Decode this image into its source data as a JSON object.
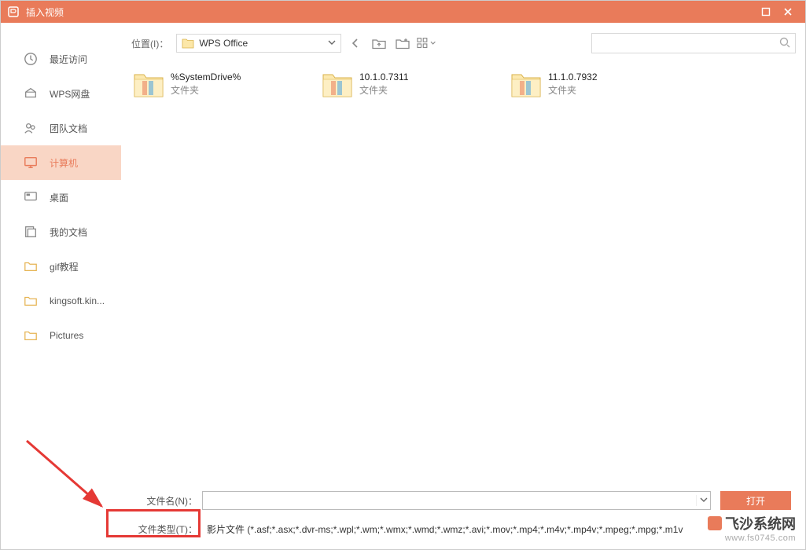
{
  "window": {
    "title": "插入视频"
  },
  "sidebar": {
    "items": [
      {
        "label": "最近访问",
        "icon": "clock"
      },
      {
        "label": "WPS网盘",
        "icon": "cloud"
      },
      {
        "label": "团队文档",
        "icon": "team"
      },
      {
        "label": "计算机",
        "icon": "monitor",
        "selected": true
      },
      {
        "label": "桌面",
        "icon": "desktop"
      },
      {
        "label": "我的文档",
        "icon": "docs"
      },
      {
        "label": "gif教程",
        "icon": "folder"
      },
      {
        "label": "kingsoft.kin...",
        "icon": "folder"
      },
      {
        "label": "Pictures",
        "icon": "folder"
      }
    ]
  },
  "toolbar": {
    "location_label": "位置(I)：",
    "location_value": "WPS Office",
    "search_placeholder": ""
  },
  "files": [
    {
      "name": "%SystemDrive%",
      "type": "文件夹"
    },
    {
      "name": "10.1.0.7311",
      "type": "文件夹"
    },
    {
      "name": "11.1.0.7932",
      "type": "文件夹"
    }
  ],
  "bottom": {
    "filename_label": "文件名(N)：",
    "filename_value": "",
    "filetype_label": "文件类型(T)：",
    "filetype_value": "影片文件 (*.asf;*.asx;*.dvr-ms;*.wpl;*.wm;*.wmx;*.wmd;*.wmz;*.avi;*.mov;*.mp4;*.m4v;*.mp4v;*.mpeg;*.mpg;*.m1v",
    "open_label": "打开"
  },
  "watermark": {
    "line1": "飞沙系统网",
    "line2": "www.fs0745.com"
  }
}
